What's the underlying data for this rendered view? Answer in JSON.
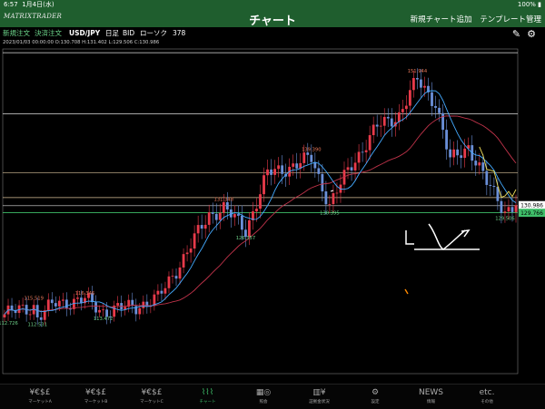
{
  "status": {
    "time": "6:57",
    "date": "1月4日(水)",
    "battery": "100%"
  },
  "header": {
    "logo": "MATRIXTRADER",
    "title": "チャート",
    "add_chart": "新規チャート追加",
    "template": "テンプレート管理"
  },
  "toolbar": {
    "new_order": "新規注文",
    "settle_order": "決済注文",
    "pair": "USD/JPY",
    "period": "日足",
    "side": "BID",
    "candle": "ローソク",
    "count": "378"
  },
  "ohlc": "2023/01/03 00:00:00  O:130.708  H:131.402  L:129.506  C:130.986",
  "chart_data": {
    "type": "candlestick",
    "pair": "USD/JPY",
    "current_price": "130.986",
    "current_price_value": 130.986,
    "line_price": "129.766",
    "line_price_value": 129.766,
    "ylim": [
      104,
      156
    ],
    "annotations": [
      {
        "label": "151.944",
        "value": 151.944,
        "kind": "high",
        "idx": 113
      },
      {
        "label": "139.390",
        "value": 139.39,
        "kind": "high",
        "idx": 84
      },
      {
        "label": "131.348",
        "value": 131.348,
        "kind": "high",
        "idx": 60
      },
      {
        "label": "116.346",
        "value": 116.346,
        "kind": "high",
        "idx": 22
      },
      {
        "label": "115.519",
        "value": 115.519,
        "kind": "high",
        "idx": 8
      },
      {
        "label": "130.395",
        "value": 130.395,
        "kind": "low",
        "idx": 89
      },
      {
        "label": "129.506",
        "value": 129.506,
        "kind": "low",
        "idx": 137
      },
      {
        "label": "126.357",
        "value": 126.357,
        "kind": "low",
        "idx": 66
      },
      {
        "label": "113.472",
        "value": 113.472,
        "kind": "low",
        "idx": 27
      },
      {
        "label": "112.726",
        "value": 112.726,
        "kind": "low",
        "idx": 1
      },
      {
        "label": "112.531",
        "value": 112.531,
        "kind": "low",
        "idx": 9
      }
    ],
    "levels": [
      {
        "value": 155.4,
        "color": "#dddddd"
      },
      {
        "value": 145.6,
        "color": "#dddddd"
      },
      {
        "value": 136.2,
        "color": "#d8c19a"
      },
      {
        "value": 132.2,
        "color": "#d8c19a"
      },
      {
        "value": 130.9,
        "color": "#dddddd"
      }
    ],
    "key_points": [
      [
        0,
        113.5
      ],
      [
        8,
        114.8
      ],
      [
        9,
        113.0
      ],
      [
        14,
        115.3
      ],
      [
        22,
        115.8
      ],
      [
        27,
        114.0
      ],
      [
        36,
        114.8
      ],
      [
        42,
        116.0
      ],
      [
        50,
        123.5
      ],
      [
        56,
        129.5
      ],
      [
        60,
        130.5
      ],
      [
        66,
        127.0
      ],
      [
        72,
        136.0
      ],
      [
        80,
        137.5
      ],
      [
        84,
        138.5
      ],
      [
        89,
        131.0
      ],
      [
        95,
        137.5
      ],
      [
        102,
        143.5
      ],
      [
        108,
        145.5
      ],
      [
        113,
        151.0
      ],
      [
        118,
        147.5
      ],
      [
        122,
        138.0
      ],
      [
        127,
        140.5
      ],
      [
        132,
        134.5
      ],
      [
        137,
        130.2
      ],
      [
        140,
        130.9
      ]
    ]
  },
  "tabs": [
    {
      "icon": "¥€$£",
      "label": "マーケットA"
    },
    {
      "icon": "¥€$£",
      "label": "マーケットB"
    },
    {
      "icon": "¥€$£",
      "label": "マーケットC"
    },
    {
      "icon": "⌇⌇⌇",
      "label": "チャート"
    },
    {
      "icon": "▦◎",
      "label": "照会"
    },
    {
      "icon": "▥¥",
      "label": "証拠金状況"
    },
    {
      "icon": "⚙",
      "label": "設定"
    },
    {
      "icon": "NEWS",
      "label": "情報"
    },
    {
      "icon": "etc.",
      "label": "その他"
    }
  ],
  "colors": {
    "header": "#1f5e2e",
    "up": "#e83a4a",
    "down": "#6a8fd8",
    "ma_short": "#44aaff",
    "ma_long": "#c0334a",
    "accent": "#3fbf6a"
  }
}
